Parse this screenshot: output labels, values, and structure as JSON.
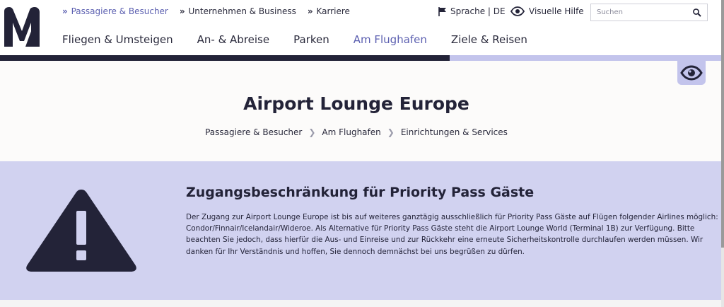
{
  "header": {
    "logo": "M",
    "top_links": [
      {
        "label": "Passagiere & Besucher"
      },
      {
        "label": "Unternehmen & Business"
      },
      {
        "label": "Karriere"
      }
    ],
    "language": "Sprache | DE",
    "visual_help": "Visuelle Hilfe",
    "search_placeholder": "Suchen",
    "nav": [
      {
        "label": "Fliegen & Umsteigen"
      },
      {
        "label": "An- & Abreise"
      },
      {
        "label": "Parken"
      },
      {
        "label": "Am Flughafen"
      },
      {
        "label": "Ziele & Reisen"
      }
    ]
  },
  "page": {
    "title": "Airport Lounge Europe",
    "breadcrumb": [
      "Passagiere & Besucher",
      "Am Flughafen",
      "Einrichtungen & Services"
    ]
  },
  "notice": {
    "title": "Zugangsbeschränkung für Priority Pass Gäste",
    "text": "Der Zugang zur Airport Lounge Europe ist bis auf weiteres ganztägig ausschließlich für Priority Pass Gäste auf Flügen folgender Airlines möglich: Condor/Finnair/Icelandair/Wideroe. Als Alternative für Priority Pass Gäste steht die Airport Lounge World (Terminal 1B) zur Verfügung. Bitte beachten Sie jedoch, dass hierfür die Aus- und Einreise und zur Rückkehr eine erneute Sicherheitskontrolle durchlaufen werden müssen. Wir danken für Ihr Verständnis und hoffen, Sie dennoch demnächst bei uns begrüßen zu dürfen."
  },
  "colors": {
    "dark": "#232338",
    "accent": "#5b5fb0",
    "notice_bg": "#d1d2f0",
    "light_bar": "#c3c4ec"
  },
  "icons": [
    "logo-m",
    "flag-icon",
    "eye-icon",
    "search-icon",
    "warning-icon"
  ]
}
